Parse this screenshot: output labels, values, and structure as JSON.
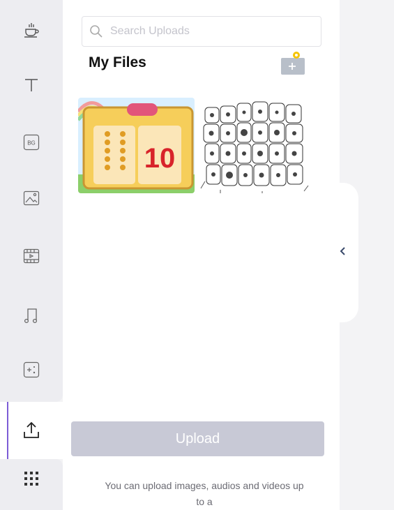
{
  "sidebar": {
    "items": [
      {
        "name": "coffee-icon"
      },
      {
        "name": "text-icon"
      },
      {
        "name": "background-icon",
        "label": "BG"
      },
      {
        "name": "image-icon"
      },
      {
        "name": "video-icon"
      },
      {
        "name": "music-icon"
      },
      {
        "name": "effects-icon"
      },
      {
        "name": "upload-icon",
        "active": true
      },
      {
        "name": "apps-grid-icon"
      }
    ]
  },
  "search": {
    "placeholder": "Search Uploads",
    "value": ""
  },
  "files": {
    "title": "My Files",
    "items": [
      {
        "name": "thumbnail-counting-10",
        "number": "10"
      },
      {
        "name": "thumbnail-cell-sketch"
      }
    ]
  },
  "upload": {
    "button_label": "Upload",
    "help_text": "You can upload images, audios and videos up to a"
  },
  "colors": {
    "accent": "#7c5cd6",
    "upload_button_disabled": "#c8c9d6",
    "folder_badge": "#f5c400"
  }
}
